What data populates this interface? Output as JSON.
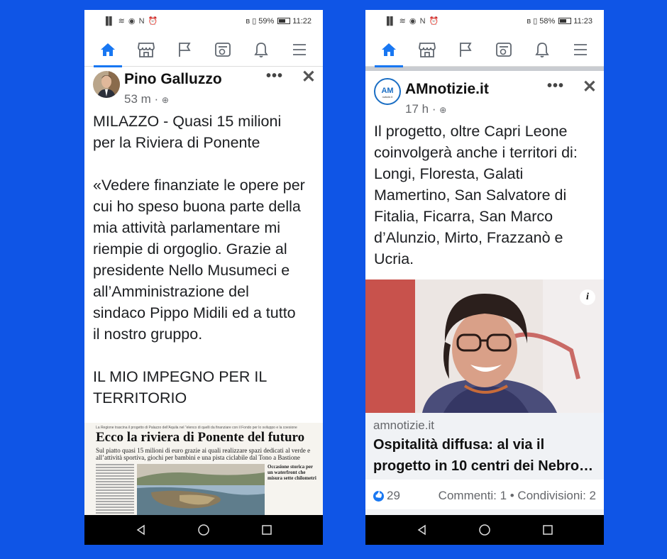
{
  "status_left": {
    "time": "11:22",
    "battery": "59%"
  },
  "status_right": {
    "time": "11:23",
    "battery": "58%"
  },
  "post1": {
    "author": "Pino Galluzzo",
    "time_ago": "53 m",
    "lines": [
      "MILAZZO - Quasi 15 milioni",
      "per la Riviera di Ponente",
      "",
      "«Vedere finanziate le opere per",
      "cui ho speso buona parte della",
      "mia attività parlamentare mi",
      "riempie di orgoglio. Grazie al",
      "presidente Nello Musumeci e",
      "all’Amministrazione del",
      "sindaco Pippo Midili ed a tutto",
      "il nostro gruppo.",
      "",
      "IL MIO IMPEGNO PER IL",
      "TERRITORIO"
    ],
    "newspaper": {
      "kicker": "La Regione trascina il progetto di Palazzo dell’Aquila nel “elenco di quelli da finanziare con il Fondo per lo sviluppo e la coesione",
      "headline": "Ecco la riviera di Ponente del futuro",
      "subheadline": "Sul piatto quasi 15 milioni di euro grazie ai quali realizzare spazi dedicati al verde e all’attività sportiva, giochi per bambini e una pista ciclabile dal Tono a Bastione",
      "side_title": "Occasione storica per un waterfront che misura sette chilometri"
    }
  },
  "post2": {
    "author": "AMnotizie.it",
    "logo_text": "AM",
    "logo_sub": "notizie.it",
    "time_ago": "17 h",
    "lines": [
      "Il progetto, oltre Capri Leone",
      "coinvolgerà anche i territori di:",
      "Longi, Floresta, Galati",
      "Mamertino, San Salvatore di",
      "Fitalia, Ficarra, San Marco",
      "d’Alunzio, Mirto, Frazzanò e",
      "Ucria."
    ],
    "link_domain": "amnotizie.it",
    "link_title_1": "Ospitalità diffusa: al via il",
    "link_title_2": "progetto in 10 centri dei Nebro…",
    "likes": "29",
    "comments": "Commenti: 1 • Condivisioni: 2"
  },
  "icons": {
    "nav": [
      "home-icon",
      "marketplace-icon",
      "pages-flag-icon",
      "watch-icon",
      "notifications-bell-icon",
      "menu-icon"
    ],
    "system": [
      "back-icon",
      "home-circle-icon",
      "recents-icon"
    ]
  },
  "colors": {
    "background": "#0f55e6",
    "facebook_blue": "#1877f2"
  }
}
